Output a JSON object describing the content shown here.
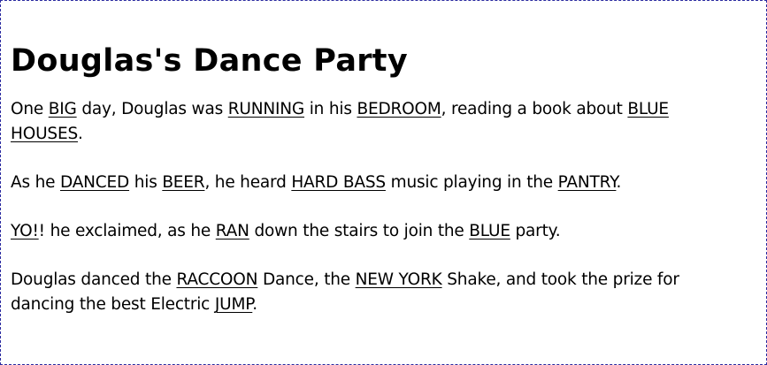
{
  "title": "Douglas's Dance Party",
  "paragraphs": [
    [
      {
        "t": "One "
      },
      {
        "t": "BIG",
        "u": true
      },
      {
        "t": " day, Douglas was "
      },
      {
        "t": "RUNNING",
        "u": true
      },
      {
        "t": " in his "
      },
      {
        "t": "BEDROOM",
        "u": true
      },
      {
        "t": ", reading a book about "
      },
      {
        "t": "BLUE HOUSES",
        "u": true
      },
      {
        "t": "."
      }
    ],
    [
      {
        "t": "As he "
      },
      {
        "t": "DANCED",
        "u": true
      },
      {
        "t": " his "
      },
      {
        "t": "BEER",
        "u": true
      },
      {
        "t": ", he heard "
      },
      {
        "t": "HARD BASS",
        "u": true
      },
      {
        "t": " music playing in the "
      },
      {
        "t": "PANTRY",
        "u": true
      },
      {
        "t": "."
      }
    ],
    [
      {
        "t": "YO!",
        "u": true
      },
      {
        "t": "! he exclaimed, as he "
      },
      {
        "t": "RAN",
        "u": true
      },
      {
        "t": " down the stairs to join the "
      },
      {
        "t": "BLUE",
        "u": true
      },
      {
        "t": " party."
      }
    ],
    [
      {
        "t": "Douglas danced the "
      },
      {
        "t": "RACCOON",
        "u": true
      },
      {
        "t": " Dance, the "
      },
      {
        "t": "NEW YORK",
        "u": true
      },
      {
        "t": " Shake, and took the prize for dancing the best Electric "
      },
      {
        "t": "JUMP",
        "u": true
      },
      {
        "t": "."
      }
    ]
  ]
}
